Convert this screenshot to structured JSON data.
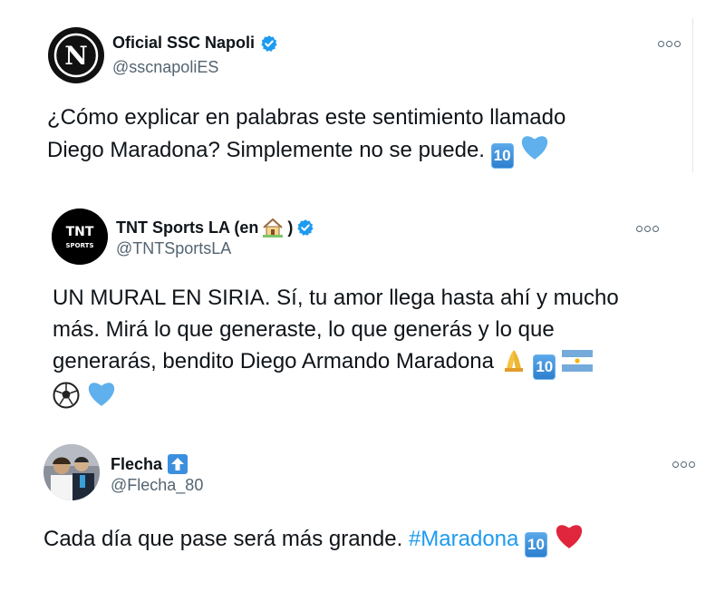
{
  "tweets": [
    {
      "display_name": "Oficial SSC Napoli",
      "handle": "@sscnapoliES",
      "avatar_letter": "N",
      "body_line1": "¿Cómo explicar en palabras este sentimiento llamado",
      "body_line2": "Diego Maradona? Simplemente no se puede.",
      "emoji_ten": "10"
    },
    {
      "display_name": "TNT Sports LA (en",
      "display_name_end": ")",
      "handle": "@TNTSportsLA",
      "avatar_top": "TNT",
      "avatar_bottom": "SPORTS",
      "body_line1": "UN MURAL EN SIRIA. Sí, tu amor llega hasta ahí y mucho",
      "body_line2": "más. Mirá lo que generaste, lo que generás y lo que",
      "body_line3": "generarás, bendito Diego Armando Maradona",
      "emoji_ten": "10"
    },
    {
      "display_name": "Flecha",
      "handle": "@Flecha_80",
      "body_text": "Cada día que pase será más grande.",
      "hashtag": "#Maradona",
      "emoji_ten": "10"
    }
  ],
  "colors": {
    "verified": "#1d9bf0",
    "hashtag": "#1d9bf0",
    "blue_heart": "#5fb0ec",
    "red_heart": "#e0263c"
  },
  "icons": [
    "verified-badge-icon",
    "more-options-icon",
    "house-emoji-icon",
    "pray-emoji-icon",
    "argentina-flag-icon",
    "soccer-ball-icon",
    "up-arrow-emoji-icon"
  ]
}
